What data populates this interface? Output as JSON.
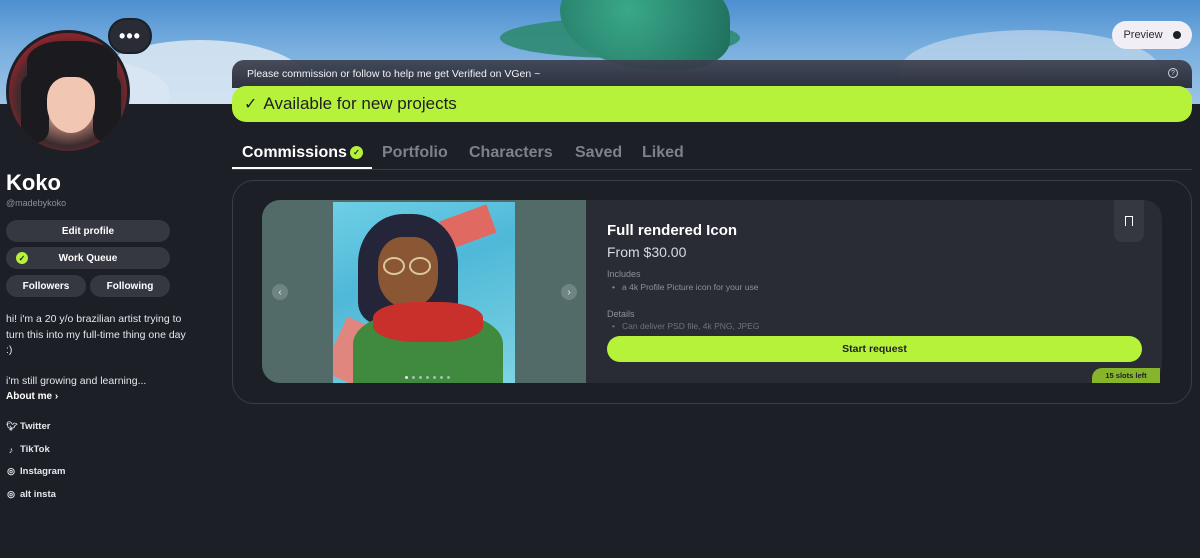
{
  "header": {
    "more_label": "•••",
    "preview_label": "Preview"
  },
  "profile": {
    "name": "Koko",
    "handle": "@madebykoko",
    "edit_profile": "Edit profile",
    "work_queue": "Work Queue",
    "followers": "Followers",
    "following": "Following",
    "bio": [
      "hi! i'm a 20 y/o brazilian artist trying to turn this into my full-time thing one day :)",
      "i'm still growing and learning..."
    ],
    "about_me": "About me ›"
  },
  "socials": [
    {
      "icon": "twitter-icon",
      "label": "Twitter"
    },
    {
      "icon": "tiktok-icon",
      "label": "TikTok"
    },
    {
      "icon": "instagram-icon",
      "label": "Instagram"
    },
    {
      "icon": "instagram-icon",
      "label": "alt insta"
    }
  ],
  "announcement": "Please commission or follow to help me get Verified on VGen ~",
  "availability": "Available for new projects",
  "tabs": [
    {
      "label": "Commissions",
      "active": true
    },
    {
      "label": "Portfolio",
      "active": false
    },
    {
      "label": "Characters",
      "active": false
    },
    {
      "label": "Saved",
      "active": false
    },
    {
      "label": "Liked",
      "active": false
    }
  ],
  "commission": {
    "title": "Full rendered Icon",
    "price": "From $30.00",
    "includes_label": "Includes",
    "includes_item": "a 4k Profile Picture icon for your use",
    "details_label": "Details",
    "details_item": "Can deliver PSD file, 4k PNG, JPEG",
    "start_label": "Start request",
    "slots_label": "15 slots left",
    "image_index": 1,
    "image_count": 7
  },
  "colors": {
    "accent": "#b7f23a",
    "background": "#1d1f27",
    "card": "#2a2c35"
  }
}
